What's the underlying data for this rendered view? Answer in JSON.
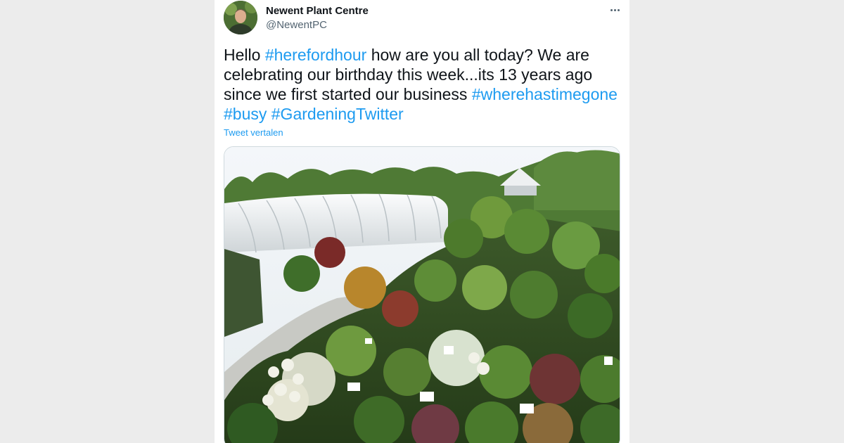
{
  "tweet": {
    "display_name": "Newent Plant Centre",
    "handle": "@NewentPC",
    "text_segments": [
      {
        "text": "Hello ",
        "tag": false
      },
      {
        "text": "#herefordhour",
        "tag": true
      },
      {
        "text": " how are you all today? We are celebrating our birthday this week...its 13 years ago since we first started our business ",
        "tag": false
      },
      {
        "text": "#wherehastimegone",
        "tag": true
      },
      {
        "text": " ",
        "tag": false
      },
      {
        "text": "#busy",
        "tag": true
      },
      {
        "text": " ",
        "tag": false
      },
      {
        "text": "#GardeningTwitter",
        "tag": true
      }
    ],
    "translate_label": "Tweet vertalen",
    "more_icon": "more-horizontal-icon"
  },
  "colors": {
    "link": "#1d9bf0",
    "text": "#0f1419",
    "secondary": "#536471",
    "page_bg": "#ececec"
  }
}
